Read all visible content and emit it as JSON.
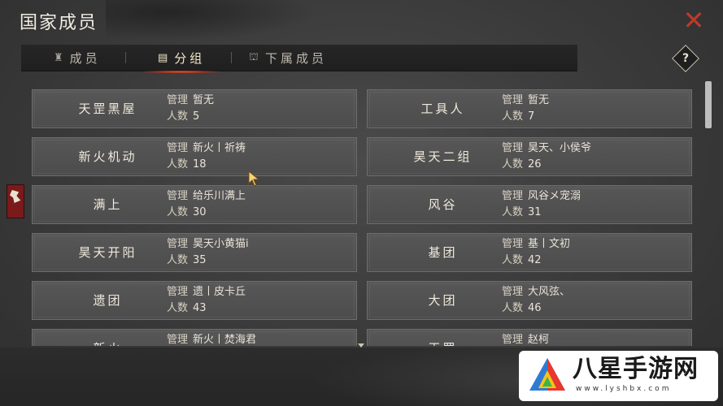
{
  "header": {
    "title": "国家成员",
    "close_icon": "close-x-icon",
    "accent": "#c0392b"
  },
  "tabs": [
    {
      "label": "成员",
      "icon": "member-icon",
      "active": false
    },
    {
      "label": "分组",
      "icon": "group-list-icon",
      "active": true
    },
    {
      "label": "下属成员",
      "icon": "subordinate-icon",
      "active": false
    }
  ],
  "help_label": "?",
  "field_labels": {
    "manager": "管理",
    "count": "人数"
  },
  "groups": [
    {
      "name": "天罡黑屋",
      "manager": "暂无",
      "count": "5"
    },
    {
      "name": "工具人",
      "manager": "暂无",
      "count": "7"
    },
    {
      "name": "新火机动",
      "manager": "新火丨祈祷",
      "count": "18"
    },
    {
      "name": "昊天二组",
      "manager": "昊天、小侯爷",
      "count": "26"
    },
    {
      "name": "满上",
      "manager": "给乐川满上",
      "count": "30"
    },
    {
      "name": "风谷",
      "manager": "风谷メ宠溺",
      "count": "31"
    },
    {
      "name": "昊天开阳",
      "manager": "昊天小黄猫i",
      "count": "35"
    },
    {
      "name": "基团",
      "manager": "基丨文初",
      "count": "42"
    },
    {
      "name": "遗团",
      "manager": "遗丨皮卡丘",
      "count": "43"
    },
    {
      "name": "大团",
      "manager": "大风弦、",
      "count": "46"
    },
    {
      "name": "新火",
      "manager": "新火丨焚海君",
      "count": ""
    },
    {
      "name": "天罡",
      "manager": "赵柯",
      "count": ""
    }
  ],
  "watermark": {
    "text": "八星手游网",
    "url": "www.lyshbx.com"
  }
}
